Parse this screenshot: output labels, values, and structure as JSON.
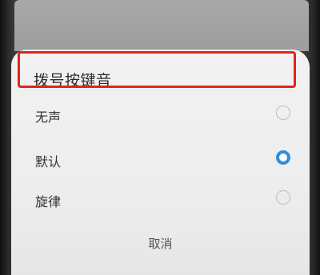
{
  "dialog": {
    "title": "拨号按键音",
    "options": [
      {
        "label": "无声",
        "selected": false
      },
      {
        "label": "默认",
        "selected": true
      },
      {
        "label": "旋律",
        "selected": false
      }
    ],
    "cancel_label": "取消"
  },
  "colors": {
    "accent": "#2f8fd8",
    "highlight": "#e2231a"
  }
}
